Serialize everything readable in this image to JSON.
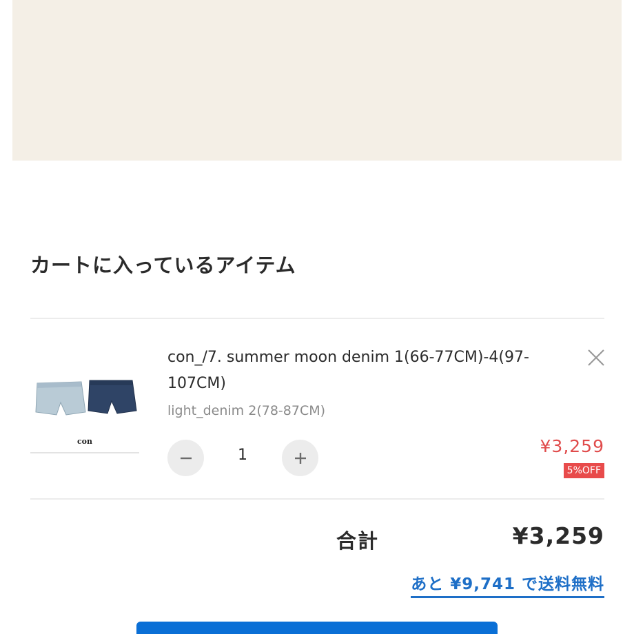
{
  "cart": {
    "title": "カートに入っているアイテム",
    "items": [
      {
        "name": "con_/7. summer moon denim 1(66-77CM)-4(97-107CM)",
        "variant": "light_denim 2(78-87CM)",
        "quantity": "1",
        "price": "¥3,259",
        "discount": "5%OFF",
        "thumb_caption": "con"
      }
    ]
  },
  "summary": {
    "total_label": "合計",
    "total_value": "¥3,259",
    "free_shipping_note": "あと ¥9,741 で送料無料"
  },
  "icons": {
    "close": "close-icon",
    "minus": "minus-icon",
    "plus": "plus-icon"
  },
  "colors": {
    "banner_bg": "#f4efe6",
    "sale_red": "#e04b4b",
    "link_blue": "#1e6fc7",
    "button_blue": "#0a6fd6"
  }
}
